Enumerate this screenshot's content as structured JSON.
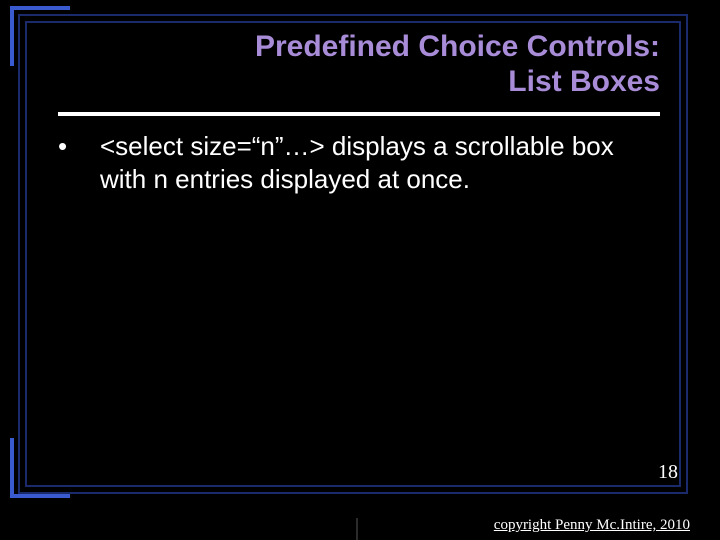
{
  "title_line1": "Predefined Choice Controls:",
  "title_line2": "List Boxes",
  "bullet": {
    "dot": "•",
    "text": "<select size=“n”…> displays a scrollable box with n entries displayed at once."
  },
  "slide_number": "18",
  "copyright": "copyright Penny Mc.Intire, 2010"
}
